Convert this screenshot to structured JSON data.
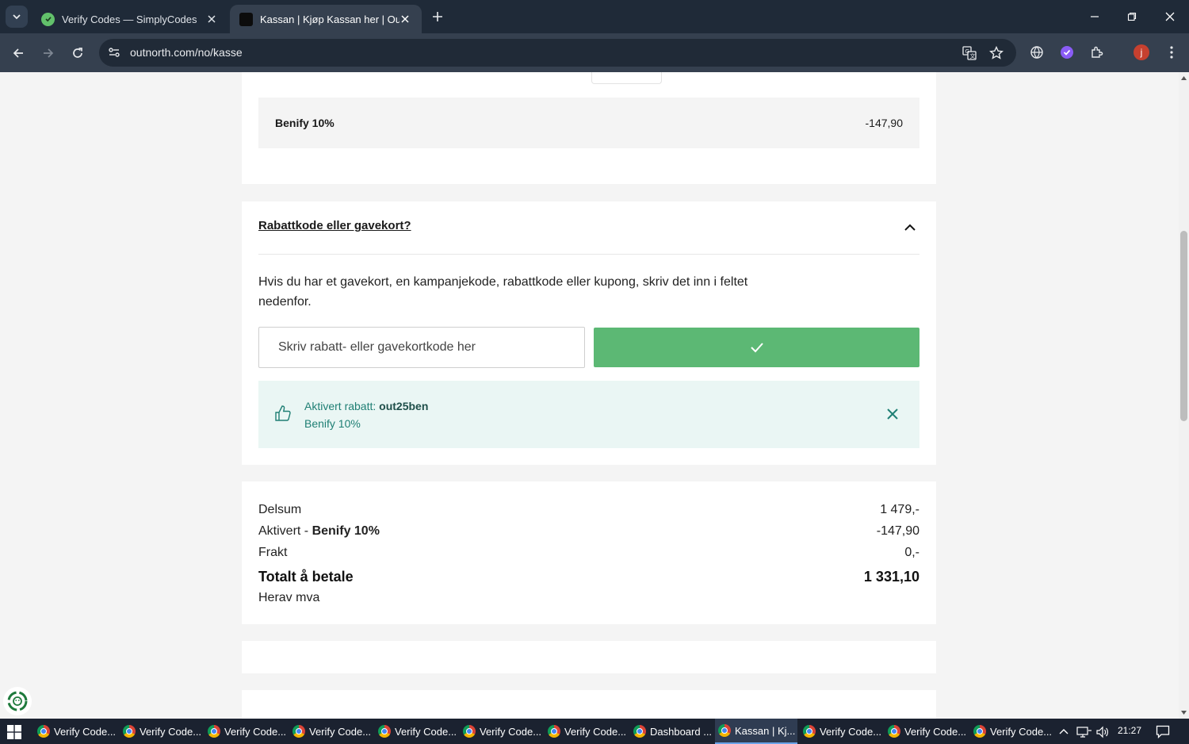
{
  "browser": {
    "tabs": [
      {
        "title": "Verify Codes — SimplyCodes",
        "active": false
      },
      {
        "title": "Kassan | Kjøp Kassan her | Outn",
        "active": true
      }
    ],
    "url": "outnorth.com/no/kasse",
    "profile_initial": "j"
  },
  "order_discount": {
    "name": "Benify 10%",
    "amount": "-147,90"
  },
  "promo": {
    "header": "Rabattkode eller gavekort?",
    "description": "Hvis du har et gavekort, en kampanjekode, rabattkode eller kupong, skriv det inn i feltet nedenfor.",
    "input_placeholder": "Skriv rabatt- eller gavekortkode her",
    "active_label": "Aktivert rabatt: ",
    "active_code": "out25ben",
    "active_name": "Benify 10%"
  },
  "summary": {
    "subtotal_label": "Delsum",
    "subtotal_value": "1 479,-",
    "discount_label_prefix": "Aktivert - ",
    "discount_label_name": "Benify 10%",
    "discount_value": "-147,90",
    "shipping_label": "Frakt",
    "shipping_value": "0,-",
    "total_label": "Totalt å betale",
    "total_value": "1 331,10",
    "vat_label": "Herav mva"
  },
  "taskbar": {
    "items": [
      {
        "label": "Verify Code...",
        "active": false
      },
      {
        "label": "Verify Code...",
        "active": false
      },
      {
        "label": "Verify Code...",
        "active": false
      },
      {
        "label": "Verify Code...",
        "active": false
      },
      {
        "label": "Verify Code...",
        "active": false
      },
      {
        "label": "Verify Code...",
        "active": false
      },
      {
        "label": "Verify Code...",
        "active": false
      },
      {
        "label": "Dashboard ...",
        "active": false
      },
      {
        "label": "Kassan | Kj...",
        "active": true
      },
      {
        "label": "Verify Code...",
        "active": false
      },
      {
        "label": "Verify Code...",
        "active": false
      },
      {
        "label": "Verify Code...",
        "active": false
      }
    ],
    "time": "21:27"
  },
  "colors": {
    "accent_green": "#5cb874",
    "active_discount_bg": "#eaf6f4",
    "active_discount_text": "#1f7f74",
    "chrome_dark": "#1f2a38"
  }
}
